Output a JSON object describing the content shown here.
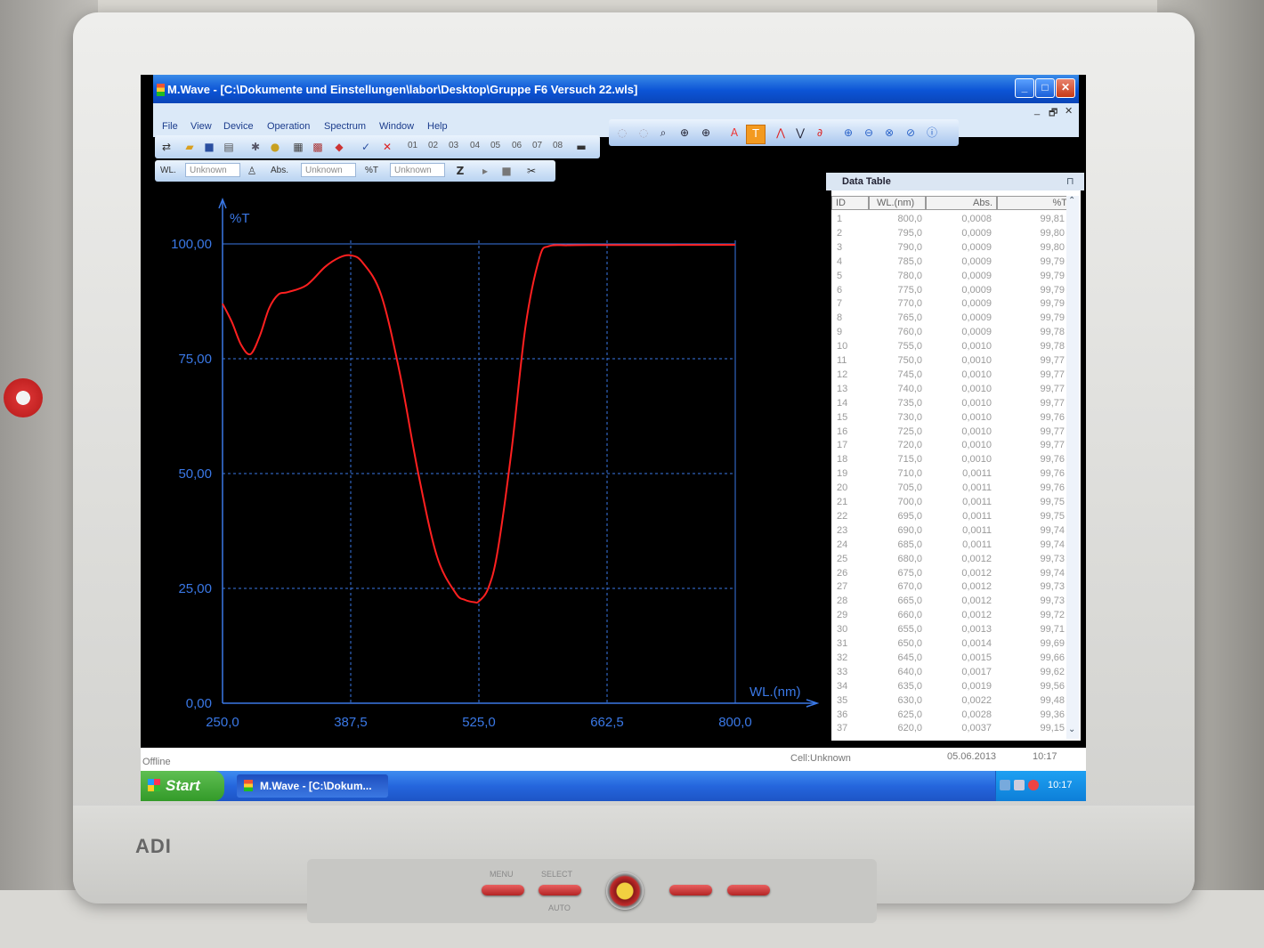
{
  "window": {
    "title": "M.Wave - [C:\\Dokumente und Einstellungen\\labor\\Desktop\\Gruppe F6 Versuch 22.wls]",
    "minimize": "_",
    "maximize": "□",
    "close": "✕",
    "mdi_minimize": "_",
    "mdi_restore": "🗗",
    "mdi_close": "✕"
  },
  "menu": [
    "File",
    "View",
    "Device",
    "Operation",
    "Spectrum",
    "Window",
    "Help"
  ],
  "toolbar": {
    "cell_numbers": [
      "01",
      "02",
      "03",
      "04",
      "05",
      "06",
      "07",
      "08"
    ],
    "icons": [
      "connect-icon",
      "open-icon",
      "save-icon",
      "print-icon",
      "settings-icon",
      "lamp-icon",
      "calc-icon",
      "grid-icon",
      "export-icon",
      "check-icon",
      "delete-icon"
    ],
    "view_icons": [
      "reset-icon",
      "pan-icon",
      "zoom-icon",
      "zoom-in-icon",
      "zoom-out-icon",
      "absorbance-icon",
      "transmission-icon",
      "peak-icon",
      "valley-icon",
      "derivative-icon",
      "add-icon",
      "subtract-icon",
      "multiply-icon",
      "divide-icon",
      "info-icon"
    ]
  },
  "readout": {
    "wl_label": "WL.",
    "wl_value": "Unknown",
    "abs_label": "Abs.",
    "abs_value": "Unknown",
    "t_label": "%T",
    "t_value": "Unknown"
  },
  "chart_data": {
    "type": "line",
    "xlabel": "WL.(nm)",
    "ylabel": "%T",
    "xlim": [
      250,
      800
    ],
    "ylim": [
      0,
      100
    ],
    "x_ticks": [
      "250,0",
      "387,5",
      "525,0",
      "662,5",
      "800,0"
    ],
    "y_ticks": [
      "0,00",
      "25,00",
      "50,00",
      "75,00",
      "100,00"
    ],
    "grid": true,
    "series": [
      {
        "color": "#ff2020",
        "x": [
          250,
          260,
          270,
          280,
          290,
          300,
          310,
          320,
          340,
          360,
          375,
          387.5,
          400,
          420,
          440,
          460,
          480,
          500,
          510,
          520,
          525,
          535,
          545,
          560,
          575,
          590,
          600,
          620,
          650,
          700,
          750,
          800
        ],
        "y": [
          87,
          83,
          78,
          76,
          80,
          86,
          89,
          89.5,
          91,
          95,
          97,
          97.5,
          96,
          89,
          72,
          50,
          32,
          24,
          22.5,
          22,
          22.2,
          25,
          33,
          55,
          82,
          97,
          99.5,
          99.7,
          99.75,
          99.75,
          99.78,
          99.81
        ]
      }
    ]
  },
  "data_table": {
    "title": "Data Table",
    "columns": [
      "ID",
      "WL.(nm)",
      "Abs.",
      "%T"
    ],
    "rows": [
      [
        "1",
        "800,0",
        "0,0008",
        "99,81"
      ],
      [
        "2",
        "795,0",
        "0,0009",
        "99,80"
      ],
      [
        "3",
        "790,0",
        "0,0009",
        "99,80"
      ],
      [
        "4",
        "785,0",
        "0,0009",
        "99,79"
      ],
      [
        "5",
        "780,0",
        "0,0009",
        "99,79"
      ],
      [
        "6",
        "775,0",
        "0,0009",
        "99,79"
      ],
      [
        "7",
        "770,0",
        "0,0009",
        "99,79"
      ],
      [
        "8",
        "765,0",
        "0,0009",
        "99,79"
      ],
      [
        "9",
        "760,0",
        "0,0009",
        "99,78"
      ],
      [
        "10",
        "755,0",
        "0,0010",
        "99,78"
      ],
      [
        "11",
        "750,0",
        "0,0010",
        "99,77"
      ],
      [
        "12",
        "745,0",
        "0,0010",
        "99,77"
      ],
      [
        "13",
        "740,0",
        "0,0010",
        "99,77"
      ],
      [
        "14",
        "735,0",
        "0,0010",
        "99,77"
      ],
      [
        "15",
        "730,0",
        "0,0010",
        "99,76"
      ],
      [
        "16",
        "725,0",
        "0,0010",
        "99,77"
      ],
      [
        "17",
        "720,0",
        "0,0010",
        "99,77"
      ],
      [
        "18",
        "715,0",
        "0,0010",
        "99,76"
      ],
      [
        "19",
        "710,0",
        "0,0011",
        "99,76"
      ],
      [
        "20",
        "705,0",
        "0,0011",
        "99,76"
      ],
      [
        "21",
        "700,0",
        "0,0011",
        "99,75"
      ],
      [
        "22",
        "695,0",
        "0,0011",
        "99,75"
      ],
      [
        "23",
        "690,0",
        "0,0011",
        "99,74"
      ],
      [
        "24",
        "685,0",
        "0,0011",
        "99,74"
      ],
      [
        "25",
        "680,0",
        "0,0012",
        "99,73"
      ],
      [
        "26",
        "675,0",
        "0,0012",
        "99,74"
      ],
      [
        "27",
        "670,0",
        "0,0012",
        "99,73"
      ],
      [
        "28",
        "665,0",
        "0,0012",
        "99,73"
      ],
      [
        "29",
        "660,0",
        "0,0012",
        "99,72"
      ],
      [
        "30",
        "655,0",
        "0,0013",
        "99,71"
      ],
      [
        "31",
        "650,0",
        "0,0014",
        "99,69"
      ],
      [
        "32",
        "645,0",
        "0,0015",
        "99,66"
      ],
      [
        "33",
        "640,0",
        "0,0017",
        "99,62"
      ],
      [
        "34",
        "635,0",
        "0,0019",
        "99,56"
      ],
      [
        "35",
        "630,0",
        "0,0022",
        "99,48"
      ],
      [
        "36",
        "625,0",
        "0,0028",
        "99,36"
      ],
      [
        "37",
        "620,0",
        "0,0037",
        "99,15"
      ]
    ]
  },
  "status": {
    "left": "Offline",
    "cell": "Cell:Unknown",
    "date": "05.06.2013",
    "time": "10:17"
  },
  "taskbar": {
    "start": "Start",
    "task": "M.Wave - [C:\\Dokum...",
    "clock": "10:17"
  },
  "monitor": {
    "brand": "ADI",
    "buttons": [
      "MENU",
      "SELECT",
      "AUTO"
    ]
  }
}
